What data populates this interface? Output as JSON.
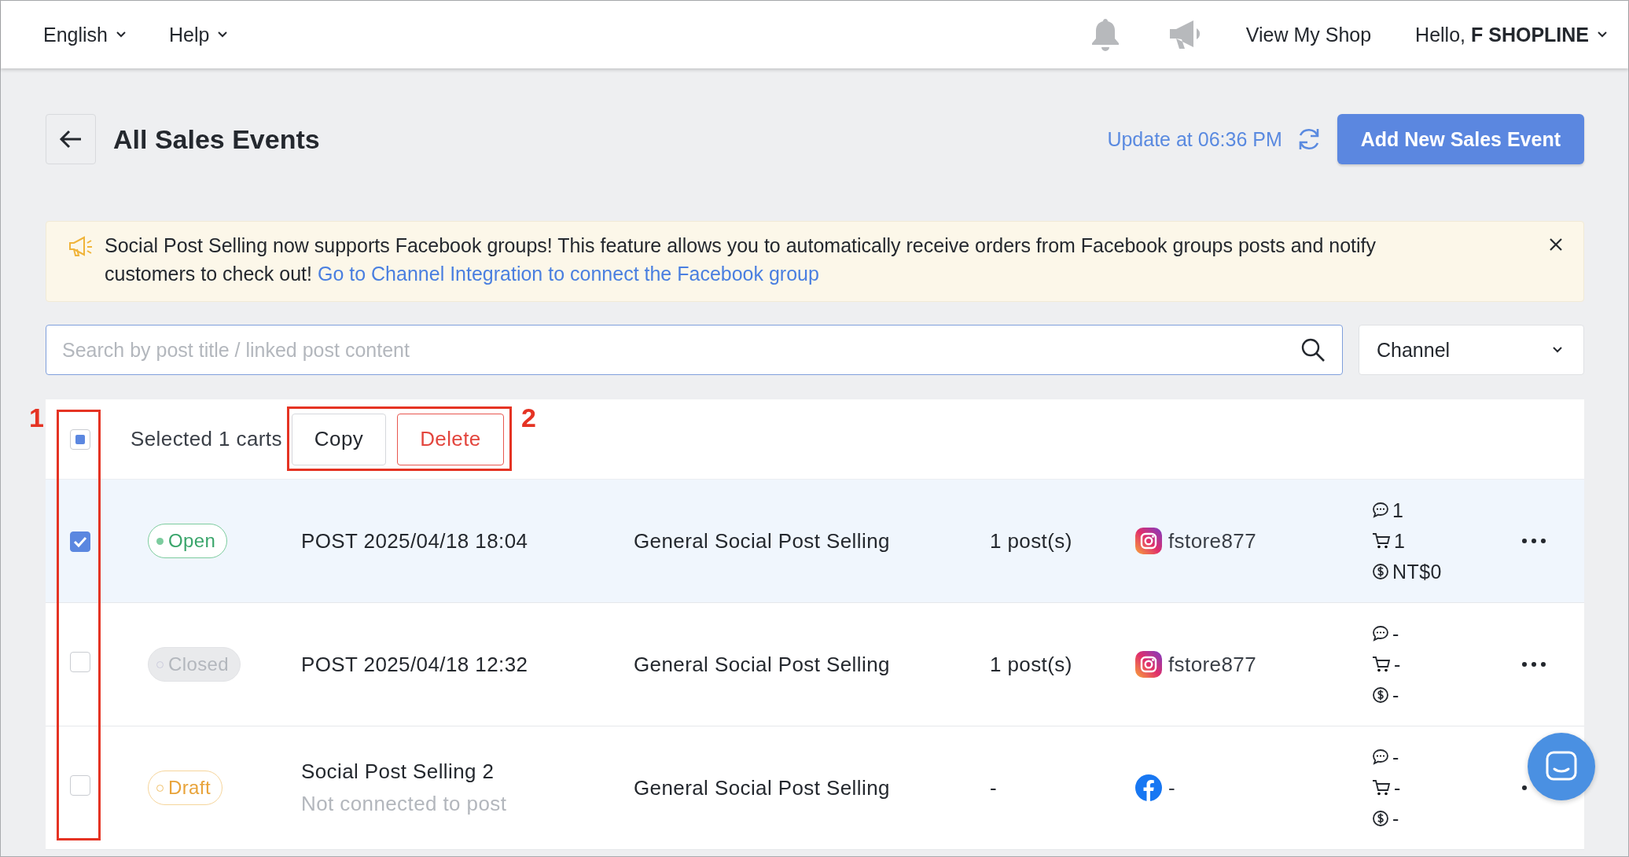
{
  "top_bar": {
    "language": "English",
    "help": "Help",
    "view_shop": "View My Shop",
    "greeting": "Hello, **F SHOPLINE**"
  },
  "header": {
    "title": "All Sales Events",
    "update": "Update at 06:36 PM",
    "add_button": "Add New Sales Event"
  },
  "banner": {
    "message": "Social Post Selling now supports Facebook groups! This feature allows you to automatically receive orders from Facebook groups posts and notify customers to check out!",
    "link": "Go to Channel Integration to connect the Facebook group"
  },
  "search": {
    "placeholder": "Search by post title / linked post content"
  },
  "channel_filter": {
    "label": "Channel"
  },
  "bulk": {
    "indeterminate": true,
    "selected_text": "Selected 1 carts",
    "actions": [
      {
        "label": "Copy",
        "kind": "default"
      },
      {
        "label": "Delete",
        "kind": "danger"
      }
    ]
  },
  "rows": [
    {
      "checked": true,
      "status": {
        "label": "Open",
        "kind": "open"
      },
      "title": "POST 2025/04/18 18:04",
      "type": "General Social Post Selling",
      "posts": "1 post(s)",
      "channel": {
        "kind": "instagram",
        "name": "fstore877"
      },
      "comments": "1",
      "carts": "1",
      "revenue": "NT$0"
    },
    {
      "checked": false,
      "status": {
        "label": "Closed",
        "kind": "closed"
      },
      "title": "POST 2025/04/18 12:32",
      "type": "General Social Post Selling",
      "posts": "1 post(s)",
      "channel": {
        "kind": "instagram",
        "name": "fstore877"
      },
      "comments": "-",
      "carts": "-",
      "revenue": "-"
    },
    {
      "checked": false,
      "status": {
        "label": "Draft",
        "kind": "draft"
      },
      "title": "Social Post Selling 2",
      "subtitle": "Not connected to post",
      "type": "General Social Post Selling",
      "posts": "-",
      "channel": {
        "kind": "facebook",
        "name": "-"
      },
      "comments": "-",
      "carts": "-",
      "revenue": "-"
    }
  ],
  "annotations": [
    {
      "label": "1"
    },
    {
      "label": "2"
    }
  ]
}
